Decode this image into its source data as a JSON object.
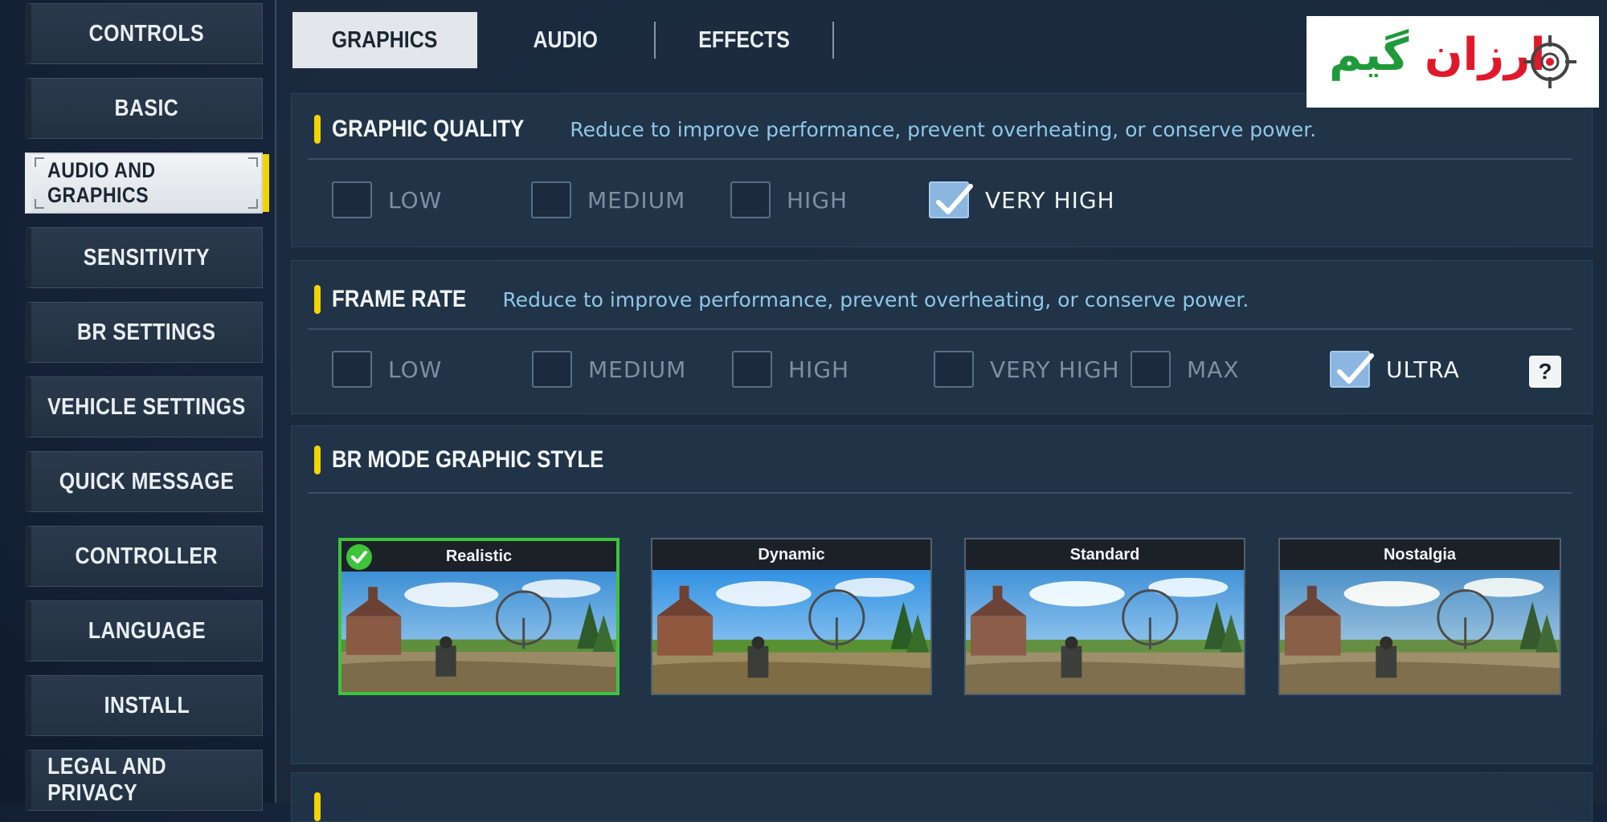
{
  "sidebar": {
    "items": [
      {
        "label": "CONTROLS",
        "active": false
      },
      {
        "label": "BASIC",
        "active": false
      },
      {
        "label": "AUDIO AND GRAPHICS",
        "active": true
      },
      {
        "label": "SENSITIVITY",
        "active": false
      },
      {
        "label": "BR SETTINGS",
        "active": false
      },
      {
        "label": "VEHICLE SETTINGS",
        "active": false
      },
      {
        "label": "QUICK MESSAGE",
        "active": false
      },
      {
        "label": "CONTROLLER",
        "active": false
      },
      {
        "label": "LANGUAGE",
        "active": false
      },
      {
        "label": "INSTALL",
        "active": false
      },
      {
        "label": "LEGAL AND PRIVACY",
        "active": false
      }
    ]
  },
  "tabs": [
    {
      "label": "GRAPHICS",
      "active": true
    },
    {
      "label": "AUDIO",
      "active": false
    },
    {
      "label": "EFFECTS",
      "active": false
    }
  ],
  "graphic_quality": {
    "title": "GRAPHIC QUALITY",
    "description": "Reduce to improve performance, prevent overheating, or conserve power.",
    "options": [
      "LOW",
      "MEDIUM",
      "HIGH",
      "VERY HIGH"
    ],
    "selected": "VERY HIGH"
  },
  "frame_rate": {
    "title": "FRAME RATE",
    "description": "Reduce to improve performance, prevent overheating, or conserve power.",
    "options": [
      "LOW",
      "MEDIUM",
      "HIGH",
      "VERY HIGH",
      "MAX",
      "ULTRA"
    ],
    "selected": "ULTRA",
    "help_label": "?"
  },
  "br_mode": {
    "title": "BR MODE GRAPHIC STYLE",
    "styles": [
      "Realistic",
      "Dynamic",
      "Standard",
      "Nostalgia"
    ],
    "selected": "Realistic"
  },
  "logo": {
    "text_red": "ارزان",
    "text_green": "گیم",
    "red_color": "#e0192a",
    "green_color": "#1f9a3a"
  },
  "colors": {
    "accent_yellow": "#f5d400",
    "selected_green": "#3ec33a",
    "description_blue": "#8fc7e8"
  }
}
